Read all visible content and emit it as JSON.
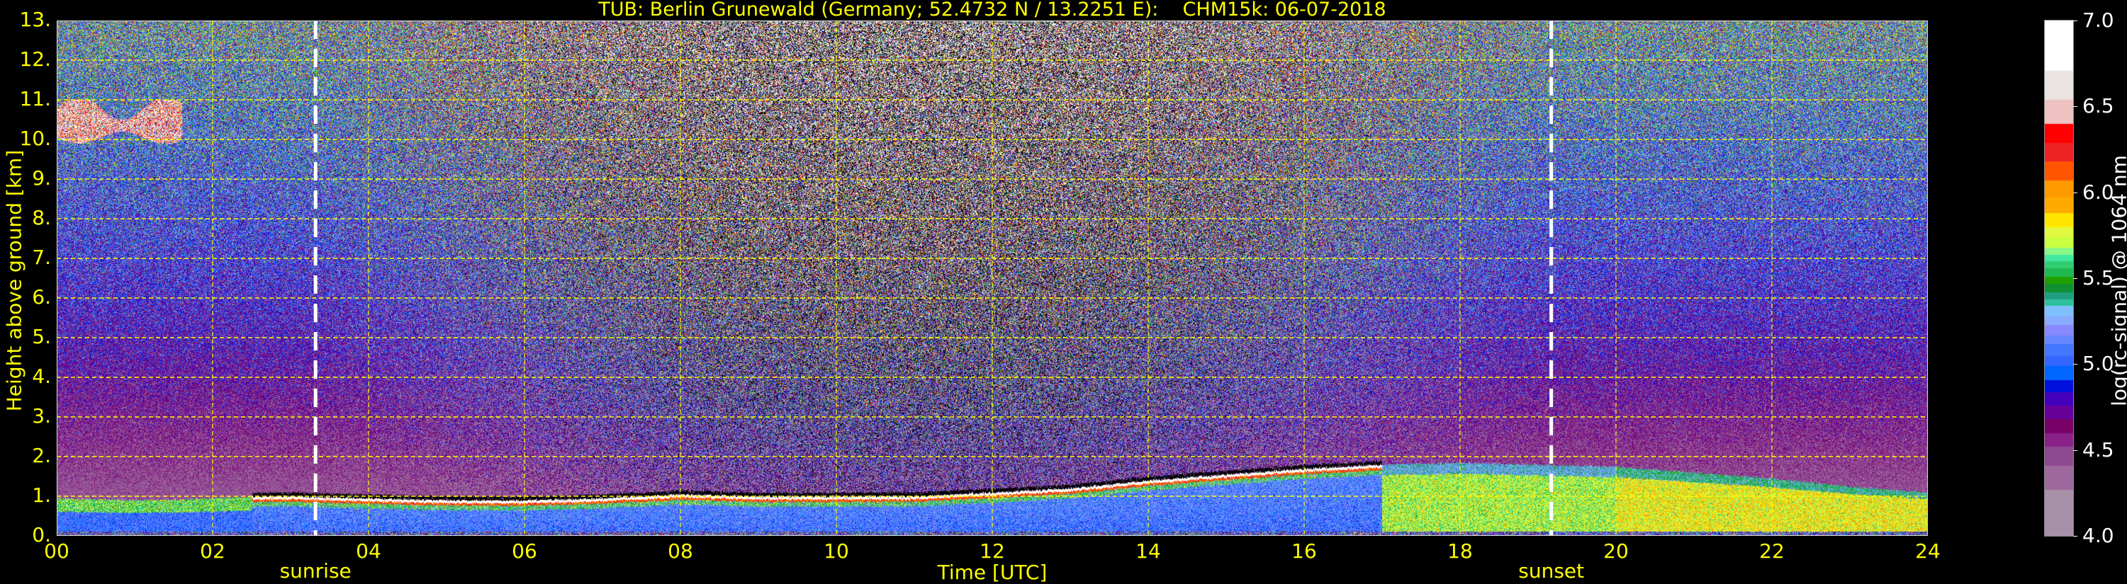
{
  "chart_data": {
    "type": "heatmap",
    "title": "TUB: Berlin Grunewald (Germany; 52.4732 N / 13.2251 E):    CHM15k: 06-07-2018",
    "xlabel": "Time [UTC]",
    "ylabel": "Height above ground [km]",
    "xlim": [
      0,
      24
    ],
    "ylim": [
      0,
      13
    ],
    "xticks": [
      "00",
      "02",
      "04",
      "06",
      "08",
      "10",
      "12",
      "14",
      "16",
      "18",
      "20",
      "22",
      "24"
    ],
    "xtick_values": [
      0,
      2,
      4,
      6,
      8,
      10,
      12,
      14,
      16,
      18,
      20,
      22,
      24
    ],
    "yticks": [
      "0.",
      "1.",
      "2.",
      "3.",
      "4.",
      "5.",
      "6.",
      "7.",
      "8.",
      "9.",
      "10.",
      "11.",
      "12.",
      "13."
    ],
    "ytick_values": [
      0,
      1,
      2,
      3,
      4,
      5,
      6,
      7,
      8,
      9,
      10,
      11,
      12,
      13
    ],
    "grid": true,
    "events": [
      {
        "label": "sunrise",
        "time": 3.32
      },
      {
        "label": "sunset",
        "time": 19.17
      }
    ],
    "colorbar": {
      "label": "log(rc-signal) @ 1064 nm",
      "range": [
        4.0,
        7.0
      ],
      "ticks": [
        "4.0",
        "4.5",
        "5.0",
        "5.5",
        "6.0",
        "6.5",
        "7.0"
      ],
      "tick_values": [
        4.0,
        4.5,
        5.0,
        5.5,
        6.0,
        6.5,
        7.0
      ],
      "levels": [
        [
          4.0,
          "#a890a8"
        ],
        [
          4.27,
          "#9e6a9e"
        ],
        [
          4.41,
          "#8e4a90"
        ],
        [
          4.52,
          "#882288"
        ],
        [
          4.6,
          "#770066"
        ],
        [
          4.68,
          "#660099"
        ],
        [
          4.76,
          "#4400bb"
        ],
        [
          4.84,
          "#0011dd"
        ],
        [
          4.91,
          "#0066ff"
        ],
        [
          4.99,
          "#3366ff"
        ],
        [
          5.05,
          "#4477ff"
        ],
        [
          5.12,
          "#6688ff"
        ],
        [
          5.17,
          "#8888ff"
        ],
        [
          5.23,
          "#88aaff"
        ],
        [
          5.28,
          "#80c0ff"
        ],
        [
          5.34,
          "#30c0a0"
        ],
        [
          5.38,
          "#20a080"
        ],
        [
          5.42,
          "#109030"
        ],
        [
          5.47,
          "#20a000"
        ],
        [
          5.51,
          "#20b850"
        ],
        [
          5.56,
          "#30cc70"
        ],
        [
          5.6,
          "#40e8a0"
        ],
        [
          5.64,
          "#88f888"
        ],
        [
          5.68,
          "#c8ff40"
        ],
        [
          5.74,
          "#e0f840"
        ],
        [
          5.8,
          "#ffe600"
        ],
        [
          5.88,
          "#ffaa00"
        ],
        [
          5.97,
          "#ff9900"
        ],
        [
          6.07,
          "#ff5500"
        ],
        [
          6.18,
          "#ee2222"
        ],
        [
          6.29,
          "#ff0000"
        ],
        [
          6.4,
          "#efc2c2"
        ],
        [
          6.54,
          "#ebe2e2"
        ],
        [
          6.71,
          "#ffffff"
        ]
      ],
      "below_range_color": "#000000"
    },
    "boundary_layer_top_km": {
      "time": [
        0,
        1,
        2,
        2.5,
        3,
        4,
        5,
        6,
        7,
        8,
        9,
        10,
        11,
        12,
        13,
        14,
        15,
        16,
        17,
        18,
        19,
        20,
        21,
        22,
        23,
        24
      ],
      "height": [
        0.95,
        0.9,
        0.95,
        1.0,
        1.0,
        0.95,
        0.9,
        0.9,
        0.95,
        1.05,
        1.0,
        1.0,
        1.0,
        1.1,
        1.2,
        1.4,
        1.55,
        1.7,
        1.8,
        1.85,
        1.8,
        1.75,
        1.6,
        1.45,
        1.25,
        1.1
      ]
    },
    "cloud_layers": [
      {
        "start": 0.0,
        "end": 1.6,
        "base_km": 9.8,
        "top_km": 11.0,
        "signal": 6.5
      }
    ],
    "aerosol_layer_signal": {
      "day_peak": 7.0,
      "evening": 5.7,
      "night": 5.6,
      "lower": 5.15
    },
    "grid_color": "#ffff00",
    "text_color": "#ffff00"
  }
}
